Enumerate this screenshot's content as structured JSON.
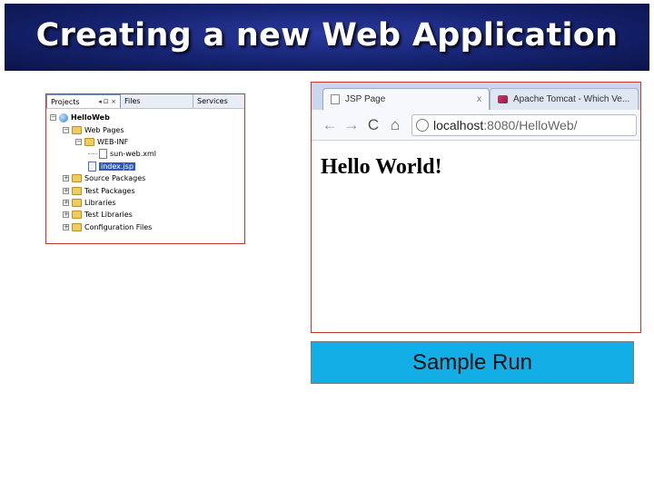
{
  "slide": {
    "title": "Creating a new Web Application",
    "caption": "Sample Run"
  },
  "ide": {
    "tabs": {
      "projects": "Projects",
      "projects_controls": "◂ ⊡ ×",
      "files": "Files",
      "services": "Services"
    },
    "tree": [
      {
        "label": "HelloWeb",
        "icon": "globe-icon",
        "bold": true
      },
      {
        "label": "Web Pages",
        "icon": "folder-icon"
      },
      {
        "label": "WEB-INF",
        "icon": "folder-icon"
      },
      {
        "label": "sun-web.xml",
        "icon": "file-icon"
      },
      {
        "label": "index.jsp",
        "icon": "jsp-file-icon",
        "selected": true
      },
      {
        "label": "Source Packages",
        "icon": "folder-icon"
      },
      {
        "label": "Test Packages",
        "icon": "folder-icon"
      },
      {
        "label": "Libraries",
        "icon": "folder-icon"
      },
      {
        "label": "Test Libraries",
        "icon": "folder-icon"
      },
      {
        "label": "Configuration Files",
        "icon": "folder-icon"
      }
    ],
    "accent_color": "#c0392b"
  },
  "browser": {
    "tabs": [
      {
        "title": "JSP Page",
        "close": "x"
      },
      {
        "title": "Apache Tomcat - Which Ve...",
        "close": ""
      }
    ],
    "nav": {
      "back": "←",
      "forward": "→",
      "reload": "C",
      "home": "⌂"
    },
    "url_host": "localhost",
    "url_rest": ":8080/HelloWeb/",
    "page_text": "Hello World!"
  },
  "colors": {
    "banner": "#15226e",
    "caption_bg": "#12aee6"
  }
}
